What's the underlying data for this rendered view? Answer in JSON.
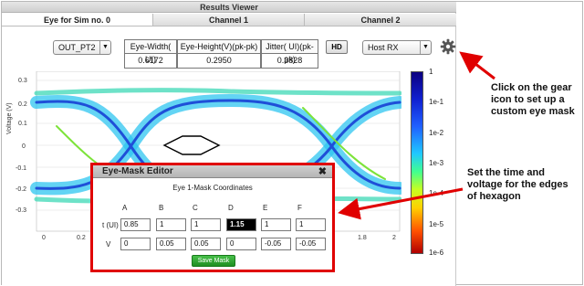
{
  "viewer": {
    "title": "Results Viewer",
    "tabs": [
      "Eye for Sim no. 0",
      "Channel 1",
      "Channel 2"
    ],
    "node_select": "OUT_PT2",
    "metrics": [
      {
        "label": "Eye-Width( UI)",
        "value": "0.6172"
      },
      {
        "label": "Eye-Height(V)(pk-pk)",
        "value": "0.2950"
      },
      {
        "label": "Jitter( UI)(pk-pk)",
        "value": "0.3828"
      }
    ],
    "hd_label": "HD",
    "rx_select": "Host RX"
  },
  "plot": {
    "ylabel": "Voltage (V)",
    "yticks": [
      "0.3",
      "0.2",
      "0.1",
      "0",
      "-0.1",
      "-0.2",
      "-0.3"
    ],
    "xticks": [
      "0",
      "0.2",
      "1.8",
      "2"
    ]
  },
  "colorbar": {
    "ticks": [
      "1",
      "1e-1",
      "1e-2",
      "1e-3",
      "1e-4",
      "1e-5",
      "1e-6"
    ]
  },
  "editor": {
    "title": "Eye-Mask Editor",
    "close": "✖",
    "subtitle": "Eye 1-Mask Coordinates",
    "columns": [
      "A",
      "B",
      "C",
      "D",
      "E",
      "F"
    ],
    "row_t_label": "t (UI)",
    "row_v_label": "V",
    "t_values": [
      "0.85",
      "1",
      "1",
      "1.15",
      "1",
      "1"
    ],
    "v_values": [
      "0",
      "0.05",
      "0.05",
      "0",
      "-0.05",
      "-0.05"
    ],
    "save_label": "Save Mask"
  },
  "annotations": {
    "gear_note": "Click on the gear icon to set up a custom eye mask",
    "editor_note": "Set the time and voltage for the edges of hexagon"
  },
  "colors": {
    "highlight": "#e00000",
    "save_button": "#2a9a2d"
  }
}
